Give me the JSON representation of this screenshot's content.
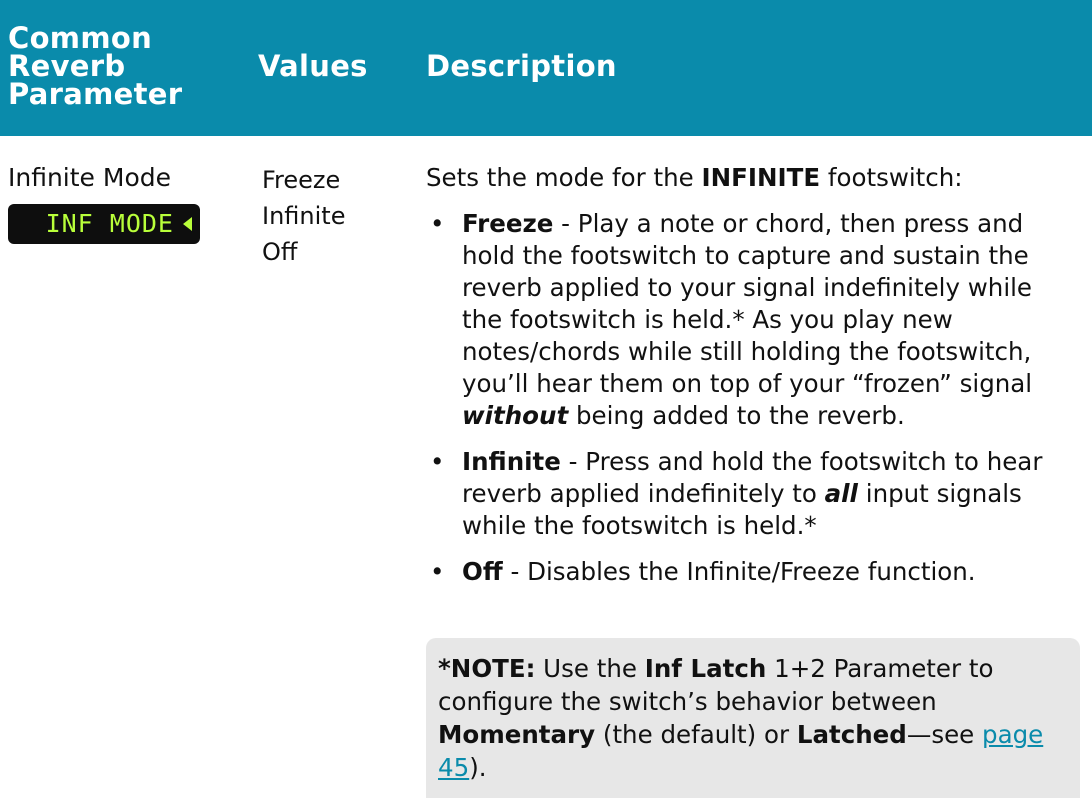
{
  "header": {
    "param_line1": "Common",
    "param_line2": "Reverb",
    "param_line3": "Parameter",
    "values": "Values",
    "description": "Description"
  },
  "row": {
    "parameter": "Infinite Mode",
    "lcd_text": "INF MODE",
    "values": [
      "Freeze",
      "Infinite",
      "Off"
    ],
    "intro_prefix": "Sets the mode for the ",
    "intro_term": "INFINITE",
    "intro_suffix": " footswitch:",
    "bullet_symbol": "•",
    "bullets": [
      {
        "term": "Freeze",
        "text_before": " - Play a note or chord, then press and hold the footswitch to capture and sustain the reverb applied to your signal indefinitely while the footswitch is held.* As you play new notes/chords while still holding the footswitch, you’ll hear them on top of your “frozen” signal ",
        "emph": "without",
        "text_after": " being added to the reverb."
      },
      {
        "term": "Infinite",
        "text_before": " - Press and hold the footswitch to hear reverb applied indefinitely to ",
        "emph": "all",
        "text_after": " input signals while the footswitch is held.*"
      },
      {
        "term": "Off",
        "text": " - Disables the Infinite/Freeze function."
      }
    ],
    "note": {
      "lead": "*NOTE:",
      "t1": " Use the ",
      "k1": "Inf Latch",
      "t2": " 1+2 Parameter to configure the switch’s behavior between ",
      "k2": "Momentary",
      "t3": " (the default) or ",
      "k3": "Latched",
      "t4": "—see ",
      "link": "page 45",
      "t5": ")."
    }
  }
}
